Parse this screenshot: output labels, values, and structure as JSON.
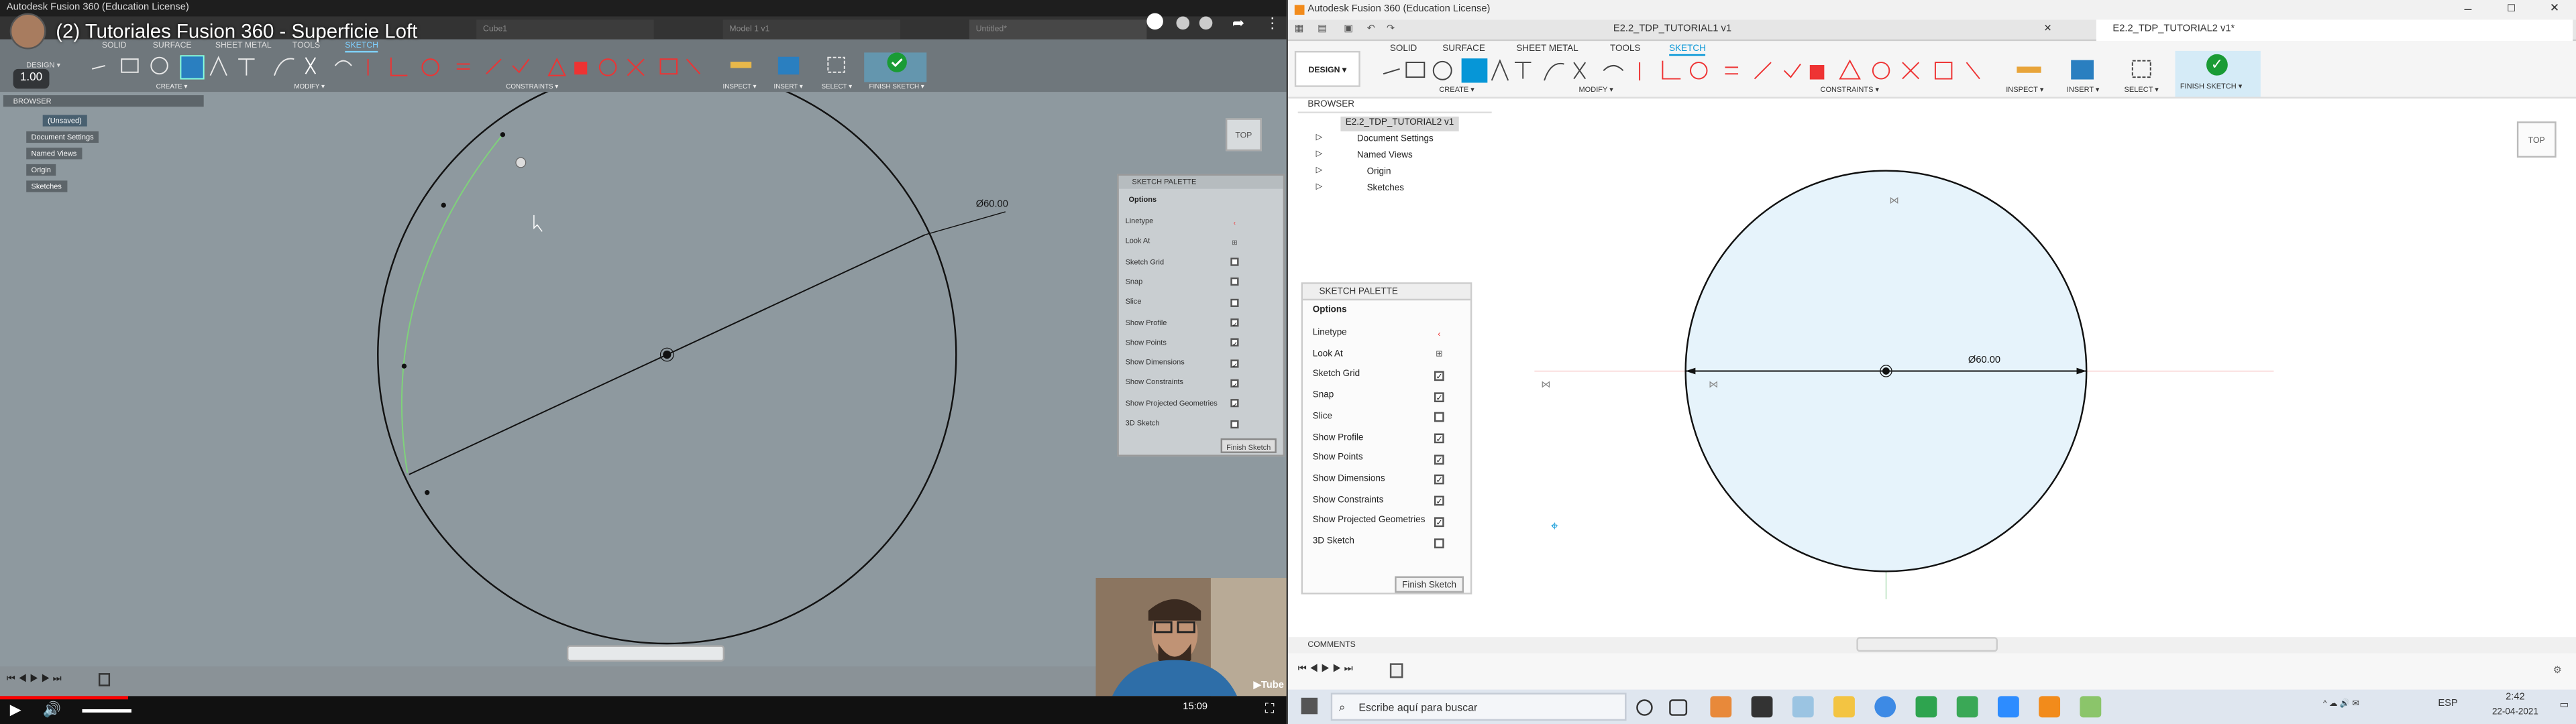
{
  "left_video": {
    "window_title": "Autodesk Fusion 360 (Education License)",
    "video_title": "(2) Tutoriales Fusion 360 - Superficie Loft",
    "speed": "1.00",
    "tabs": [
      "Untitled*"
    ],
    "ribbon_tabs": [
      "SOLID",
      "SURFACE",
      "SHEET METAL",
      "TOOLS",
      "SKETCH"
    ],
    "design_label": "DESIGN ▾",
    "groups": [
      "CREATE ▾",
      "MODIFY ▾",
      "CONSTRAINTS ▾",
      "INSPECT ▾",
      "INSERT ▾",
      "SELECT ▾",
      "FINISH SKETCH ▾"
    ],
    "browser_label": "BROWSER",
    "browser_items": [
      "(Unsaved)",
      "Document Settings",
      "Named Views",
      "Origin",
      "Sketches"
    ],
    "dimension": "Ø60.00",
    "viewcube": "TOP",
    "palette": {
      "title": "SKETCH PALETTE",
      "section": "Options",
      "rows": [
        {
          "label": "Linetype",
          "checked": null
        },
        {
          "label": "Look At",
          "checked": null
        },
        {
          "label": "Sketch Grid",
          "checked": false
        },
        {
          "label": "Snap",
          "checked": false
        },
        {
          "label": "Slice",
          "checked": false
        },
        {
          "label": "Show Profile",
          "checked": true
        },
        {
          "label": "Show Points",
          "checked": true
        },
        {
          "label": "Show Dimensions",
          "checked": true
        },
        {
          "label": "Show Constraints",
          "checked": true
        },
        {
          "label": "Show Projected Geometries",
          "checked": true
        },
        {
          "label": "3D Sketch",
          "checked": false
        }
      ],
      "finish_button": "Finish Sketch"
    },
    "player": {
      "time": "15:09",
      "progress": 0.1
    }
  },
  "right_app": {
    "window_title": "Autodesk Fusion 360 (Education License)",
    "tabs": [
      {
        "label": "E2.2_TDP_TUTORIAL1 v1",
        "active": false
      },
      {
        "label": "E2.2_TDP_TUTORIAL2 v1*",
        "active": true
      }
    ],
    "design_label": "DESIGN ▾",
    "ribbon_tabs": [
      "SOLID",
      "SURFACE",
      "SHEET METAL",
      "TOOLS",
      "SKETCH"
    ],
    "active_tab": "SKETCH",
    "groups": [
      "CREATE ▾",
      "MODIFY ▾",
      "CONSTRAINTS ▾",
      "INSPECT ▾",
      "INSERT ▾",
      "SELECT ▾",
      "FINISH SKETCH ▾"
    ],
    "browser": {
      "label": "BROWSER",
      "root": "E2.2_TDP_TUTORIAL2 v1",
      "items": [
        "Document Settings",
        "Named Views",
        "Origin",
        "Sketches"
      ]
    },
    "dimension": "Ø60.00",
    "viewcube": "TOP",
    "palette": {
      "title": "SKETCH PALETTE",
      "section": "Options",
      "rows": [
        {
          "label": "Linetype",
          "checked": null
        },
        {
          "label": "Look At",
          "checked": null
        },
        {
          "label": "Sketch Grid",
          "checked": true
        },
        {
          "label": "Snap",
          "checked": true
        },
        {
          "label": "Slice",
          "checked": false
        },
        {
          "label": "Show Profile",
          "checked": true
        },
        {
          "label": "Show Points",
          "checked": true
        },
        {
          "label": "Show Dimensions",
          "checked": true
        },
        {
          "label": "Show Constraints",
          "checked": true
        },
        {
          "label": "Show Projected Geometries",
          "checked": true
        },
        {
          "label": "3D Sketch",
          "checked": false
        }
      ],
      "finish_button": "Finish Sketch"
    },
    "comments_label": "COMMENTS",
    "taskbar": {
      "search_placeholder": "Escribe aquí para buscar",
      "time": "2:42",
      "date": "22-04-2021",
      "lang": "ESP"
    }
  },
  "colors": {
    "accent": "#0696d7",
    "finish": "#1a9b35",
    "profile_fill": "#e6f3fb"
  }
}
